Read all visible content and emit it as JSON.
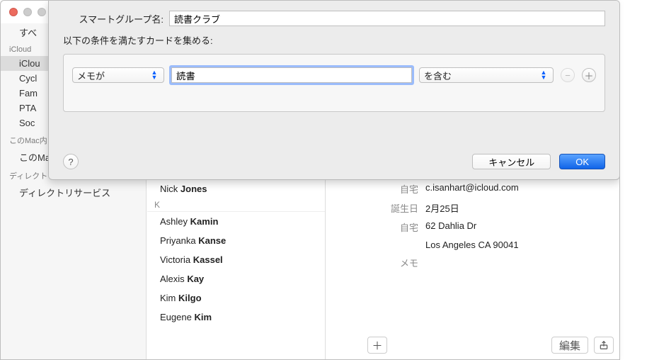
{
  "sidebar": {
    "top_item": "すべ",
    "headers": {
      "icloud": "iCloud",
      "thismac": "このMac内",
      "directory": "ディレクトリ"
    },
    "icloud_items": [
      "iClou",
      "Cycl",
      "Fam",
      "PTA",
      "Soc"
    ],
    "thismac_items": [
      "このMacにある連絡先"
    ],
    "directory_items": [
      "ディレクトリサービス"
    ]
  },
  "list": {
    "rows_before": [
      {
        "first": "Nick",
        "last": "Jones"
      }
    ],
    "section": "K",
    "rows": [
      {
        "first": "Ashley",
        "last": "Kamin"
      },
      {
        "first": "Priyanka",
        "last": "Kanse"
      },
      {
        "first": "Victoria",
        "last": "Kassel"
      },
      {
        "first": "Alexis",
        "last": "Kay"
      },
      {
        "first": "Kim",
        "last": "Kilgo"
      },
      {
        "first": "Eugene",
        "last": "Kim"
      }
    ]
  },
  "detail": {
    "fields": [
      {
        "label": "自宅",
        "value": "c.isanhart@icloud.com"
      },
      {
        "label": "誕生日",
        "value": "2月25日"
      },
      {
        "label": "自宅",
        "value": "62 Dahlia Dr"
      },
      {
        "label": "",
        "value": "Los Angeles CA 90041"
      },
      {
        "label": "メモ",
        "value": ""
      }
    ],
    "edit": "編集"
  },
  "sheet": {
    "name_label": "スマートグループ名:",
    "name_value": "読書クラブ",
    "cond_label": "以下の条件を満たすカードを集める:",
    "field_popup": "メモが",
    "match_value": "読書",
    "op_popup": "を含む",
    "cancel": "キャンセル",
    "ok": "OK",
    "help": "?"
  }
}
